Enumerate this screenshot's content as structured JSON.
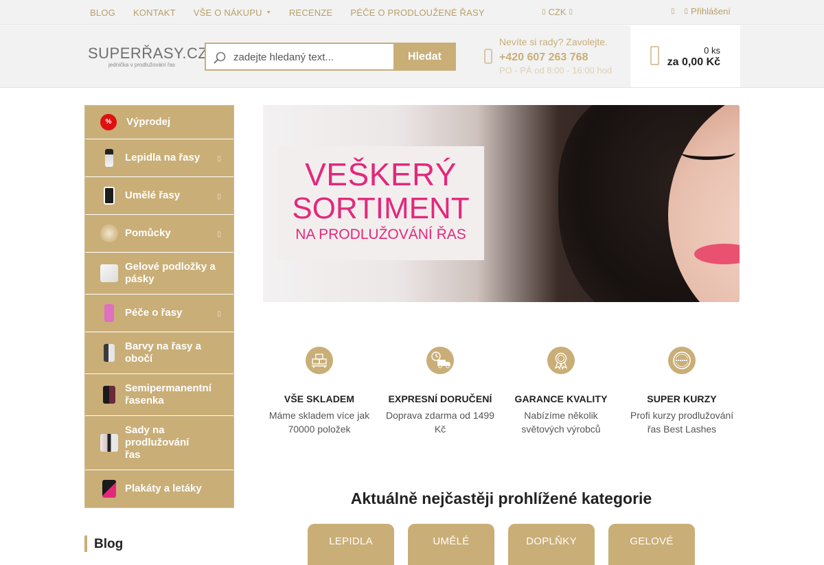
{
  "topnav": {
    "items": [
      {
        "label": "BLOG"
      },
      {
        "label": "KONTAKT"
      },
      {
        "label": "VŠE O NÁKUPU"
      },
      {
        "label": "RECENZE"
      },
      {
        "label": "PÉČE O PRODLOUŽENÉ ŘASY"
      }
    ],
    "currency": "CZK",
    "login": "Přihlášení"
  },
  "header": {
    "logo_text": "SUPERŘASY.CZ",
    "logo_tagline": "jednička v prodlužování řas",
    "search": {
      "placeholder": "zadejte hledaný text...",
      "button": "Hledat"
    },
    "contact": {
      "question": "Nevíte si rady? Zavolejte.",
      "phone": "+420 607 263 768",
      "hours": "PO - PÁ od 8:00 - 16:00 hod"
    },
    "cart": {
      "count": "0 ks",
      "total": "za 0,00 Kč"
    }
  },
  "sidebar": {
    "items": [
      {
        "label": "Výprodej"
      },
      {
        "label": "Lepidla na řasy"
      },
      {
        "label": "Umělé řasy"
      },
      {
        "label": "Pomůcky"
      },
      {
        "label": "Gelové podložky a pásky"
      },
      {
        "label": "Péče o řasy"
      },
      {
        "label": "Barvy na řasy a obočí"
      },
      {
        "label": "Semipermanentní řasenka"
      },
      {
        "label": "Sady na prodlužování řas"
      },
      {
        "label": "Plakáty a letáky"
      }
    ],
    "sale_badge": "%"
  },
  "blog_heading": "Blog",
  "banner": {
    "line1": "VEŠKERÝ",
    "line2": "SORTIMENT",
    "line3": "NA PRODLUŽOVÁNÍ ŘAS"
  },
  "features": [
    {
      "title": "VŠE SKLADEM",
      "desc": "Máme skladem více jak 70000 položek",
      "icon": "warehouse-icon"
    },
    {
      "title": "EXPRESNÍ DORUČENÍ",
      "desc": "Doprava zdarma od 1499 Kč",
      "icon": "delivery-truck-icon"
    },
    {
      "title": "GARANCE KVALITY",
      "desc": "Nabízíme několik světových výrobců",
      "icon": "quality-medal-icon"
    },
    {
      "title": "SUPER KURZY",
      "desc": "Profi kurzy prodlužování řas Best Lashes",
      "icon": "certified-icon"
    }
  ],
  "categories_heading": "Aktuálně nejčastěji prohlížené kategorie",
  "categories": [
    {
      "label": "LEPIDLA"
    },
    {
      "label": "UMĚLÉ"
    },
    {
      "label": "DOPLŇKY"
    },
    {
      "label": "GELOVÉ"
    }
  ],
  "colors": {
    "accent": "#c9ae77",
    "banner_pink": "#e3287b"
  }
}
